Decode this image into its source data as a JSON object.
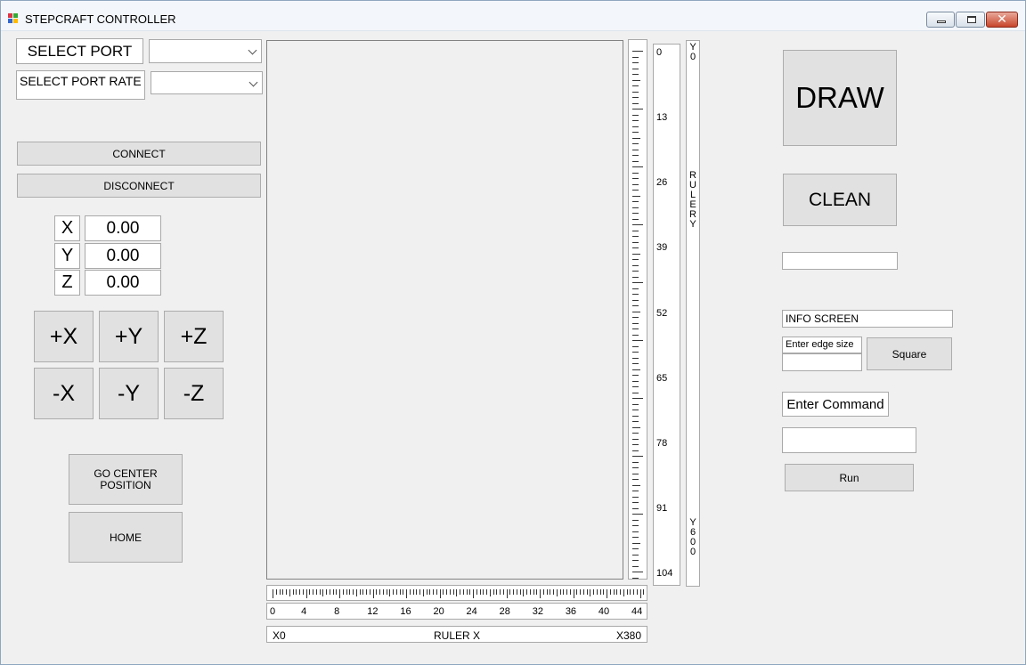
{
  "window": {
    "title": "STEPCRAFT CONTROLLER",
    "close_glyph": "✕"
  },
  "port": {
    "select_port_label": "SELECT PORT",
    "select_rate_label": "SELECT PORT RATE",
    "port_value": "",
    "rate_value": ""
  },
  "connection": {
    "connect_label": "CONNECT",
    "disconnect_label": "DISCONNECT"
  },
  "coords": [
    {
      "axis": "X",
      "value": "0.00"
    },
    {
      "axis": "Y",
      "value": "0.00"
    },
    {
      "axis": "Z",
      "value": "0.00"
    }
  ],
  "jog": {
    "plus_x": "+X",
    "plus_y": "+Y",
    "plus_z": "+Z",
    "minus_x": "-X",
    "minus_y": "-Y",
    "minus_z": "-Z"
  },
  "position": {
    "go_center_label": "GO CENTER\nPOSITION",
    "home_label": "HOME"
  },
  "ruler_y": {
    "labels": [
      "0",
      "13",
      "26",
      "39",
      "52",
      "65",
      "78",
      "91",
      "104"
    ],
    "title_top": "Y0",
    "title_mid": "RULERY",
    "title_bottom": "Y600"
  },
  "ruler_x": {
    "labels": [
      "0",
      "4",
      "8",
      "12",
      "16",
      "20",
      "24",
      "28",
      "32",
      "36",
      "40",
      "44"
    ],
    "left_label": "X0",
    "mid_label": "RULER X",
    "right_label": "X380"
  },
  "actions": {
    "draw_label": "DRAW",
    "clean_label": "CLEAN",
    "status_value": "",
    "info_screen": "INFO SCREEN",
    "edge_size_label": "Enter edge size",
    "edge_size_value": "",
    "square_label": "Square",
    "enter_command_label": "Enter Command",
    "command_value": "",
    "run_label": "Run"
  }
}
